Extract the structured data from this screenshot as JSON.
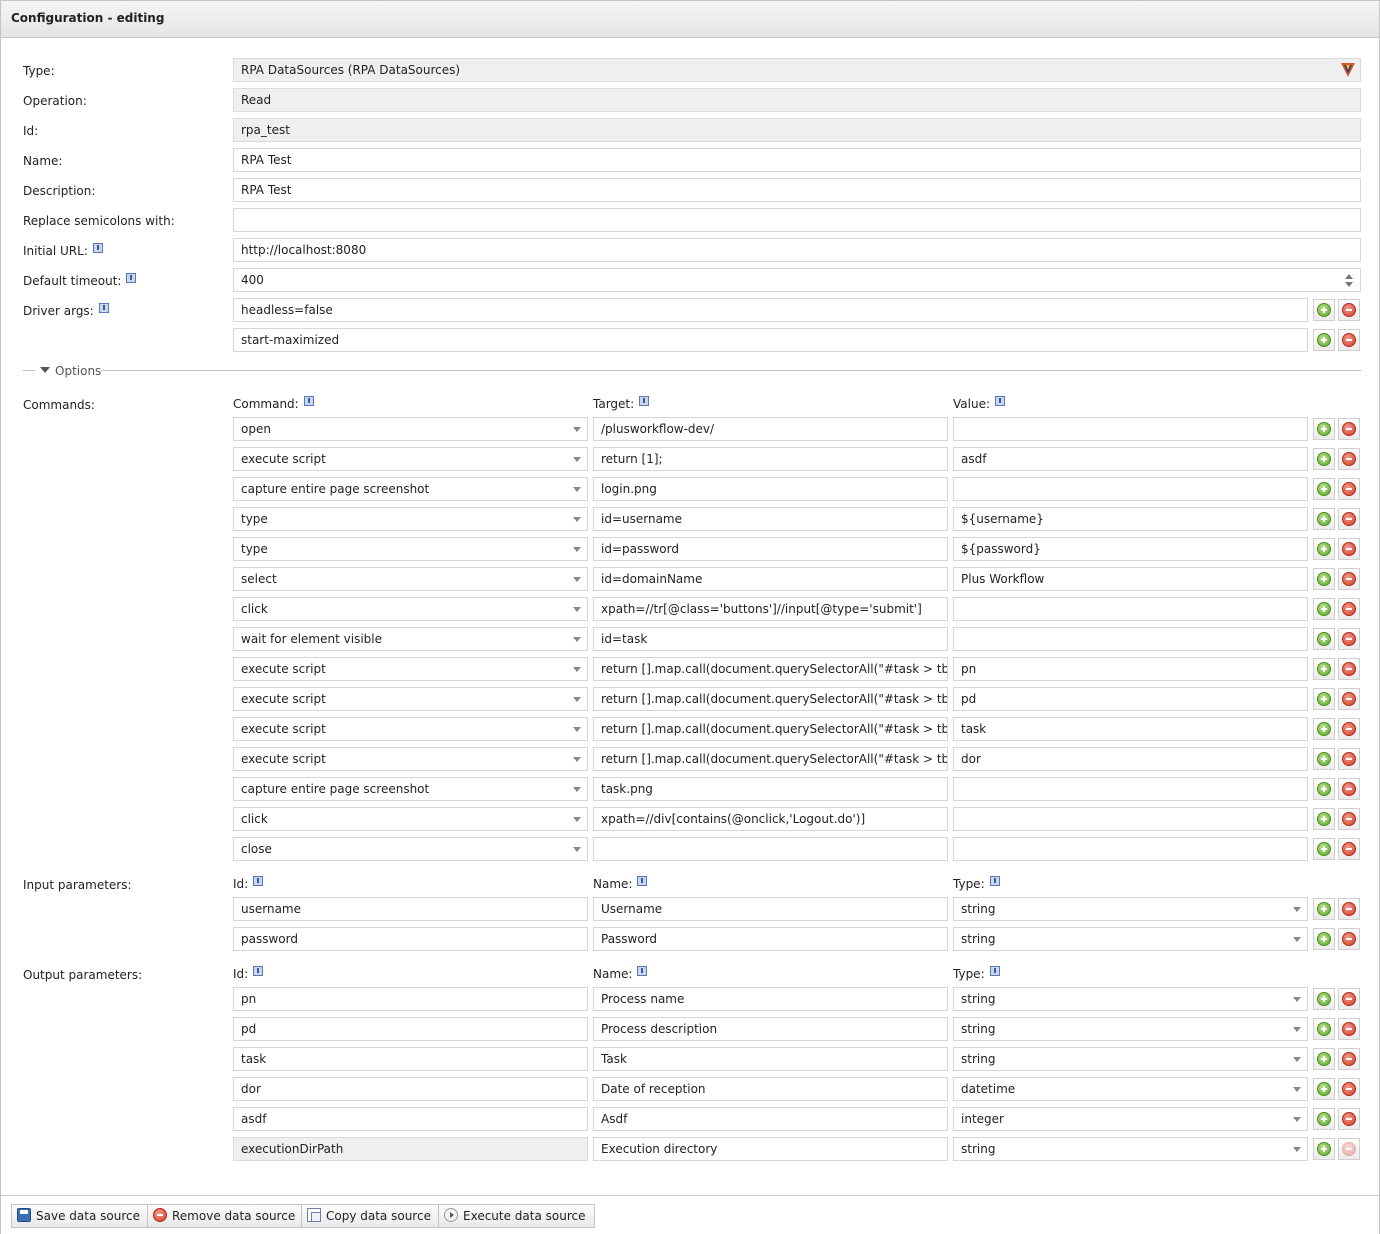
{
  "window": {
    "title": "Configuration - editing"
  },
  "form": {
    "type": {
      "label": "Type:",
      "value": "RPA DataSources (RPA DataSources)"
    },
    "operation": {
      "label": "Operation:",
      "value": "Read"
    },
    "id": {
      "label": "Id:",
      "value": "rpa_test"
    },
    "name": {
      "label": "Name:",
      "value": "RPA Test"
    },
    "description": {
      "label": "Description:",
      "value": "RPA Test"
    },
    "replace_semicolons": {
      "label": "Replace semicolons with:",
      "value": ""
    },
    "initial_url": {
      "label": "Initial URL:",
      "value": "http://localhost:8080"
    },
    "default_timeout": {
      "label": "Default timeout:",
      "value": "400"
    },
    "driver_args": {
      "label": "Driver args:",
      "values": [
        "headless=false",
        "start-maximized"
      ]
    }
  },
  "options": {
    "label": "Options"
  },
  "commands": {
    "label": "Commands:",
    "headers": {
      "command": "Command:",
      "target": "Target:",
      "value": "Value:"
    },
    "rows": [
      {
        "command": "open",
        "target": "/plusworkflow-dev/",
        "value": ""
      },
      {
        "command": "execute script",
        "target": "return [1];",
        "value": "asdf"
      },
      {
        "command": "capture entire page screenshot",
        "target": "login.png",
        "value": ""
      },
      {
        "command": "type",
        "target": "id=username",
        "value": "${username}"
      },
      {
        "command": "type",
        "target": "id=password",
        "value": "${password}"
      },
      {
        "command": "select",
        "target": "id=domainName",
        "value": "Plus Workflow"
      },
      {
        "command": "click",
        "target": "xpath=//tr[@class='buttons']//input[@type='submit']",
        "value": ""
      },
      {
        "command": "wait for element visible",
        "target": "id=task",
        "value": ""
      },
      {
        "command": "execute script",
        "target": "return [].map.call(document.querySelectorAll(\"#task > tboc",
        "value": "pn"
      },
      {
        "command": "execute script",
        "target": "return [].map.call(document.querySelectorAll(\"#task > tboc",
        "value": "pd"
      },
      {
        "command": "execute script",
        "target": "return [].map.call(document.querySelectorAll(\"#task > tboc",
        "value": "task"
      },
      {
        "command": "execute script",
        "target": "return [].map.call(document.querySelectorAll(\"#task > tboc",
        "value": "dor"
      },
      {
        "command": "capture entire page screenshot",
        "target": "task.png",
        "value": ""
      },
      {
        "command": "click",
        "target": "xpath=//div[contains(@onclick,'Logout.do')]",
        "value": ""
      },
      {
        "command": "close",
        "target": "",
        "value": ""
      }
    ]
  },
  "input_parameters": {
    "label": "Input parameters:",
    "headers": {
      "id": "Id:",
      "name": "Name:",
      "type": "Type:"
    },
    "rows": [
      {
        "id": "username",
        "name": "Username",
        "type": "string"
      },
      {
        "id": "password",
        "name": "Password",
        "type": "string"
      }
    ]
  },
  "output_parameters": {
    "label": "Output parameters:",
    "headers": {
      "id": "Id:",
      "name": "Name:",
      "type": "Type:"
    },
    "rows": [
      {
        "id": "pn",
        "name": "Process name",
        "type": "string"
      },
      {
        "id": "pd",
        "name": "Process description",
        "type": "string"
      },
      {
        "id": "task",
        "name": "Task",
        "type": "string"
      },
      {
        "id": "dor",
        "name": "Date of reception",
        "type": "datetime"
      },
      {
        "id": "asdf",
        "name": "Asdf",
        "type": "integer"
      },
      {
        "id": "executionDirPath",
        "name": "Execution directory",
        "type": "string",
        "readonly": true
      }
    ]
  },
  "footer": {
    "save": "Save data source",
    "remove": "Remove data source",
    "copy": "Copy data source",
    "execute": "Execute data source"
  },
  "colors": {
    "add": "#5ea62b",
    "remove": "#d33b27",
    "border": "#d6d6d6",
    "readonly_bg": "#efefef"
  },
  "icons": [
    "info-icon",
    "add-icon",
    "remove-icon",
    "chevron-down-icon",
    "save-icon",
    "remove-circle-icon",
    "copy-icon",
    "execute-icon",
    "collapse-triangle-icon"
  ]
}
